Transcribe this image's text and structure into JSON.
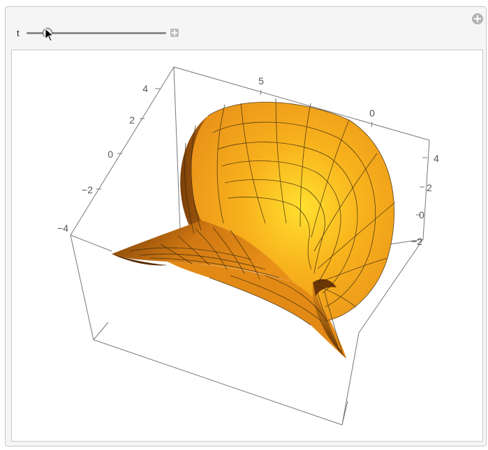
{
  "slider": {
    "label": "t",
    "value_fraction": 0.15
  },
  "icons": {
    "corner": "plus-circle-icon",
    "expand": "plus-square-icon",
    "cursor": "mouse-pointer-icon",
    "thumb": "slider-thumb-icon"
  },
  "plot": {
    "type": "3d-surface",
    "axis_ticks": {
      "left_vertical": [
        "4",
        "2",
        "0",
        "−2",
        "−4"
      ],
      "top": [
        "5",
        "0"
      ],
      "right_vertical": [
        "4",
        "2",
        "0",
        "−2"
      ]
    },
    "colors": {
      "surface_dark": "#8a4a08",
      "surface_mid": "#f09a18",
      "surface_light": "#ffe030",
      "box_line": "#777777",
      "mesh": "#3a2a10"
    }
  }
}
